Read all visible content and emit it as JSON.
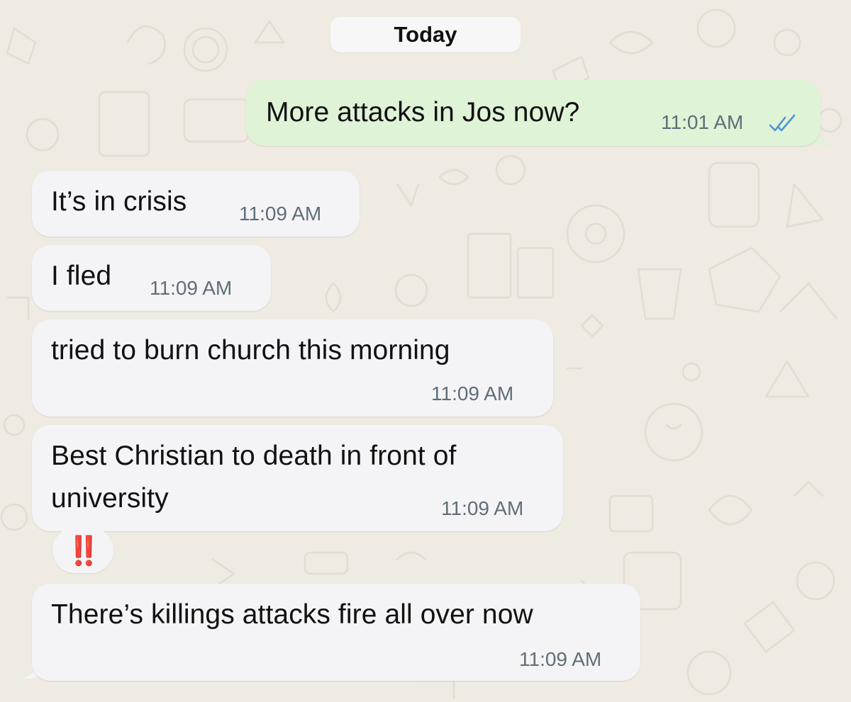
{
  "chat": {
    "date_label": "Today",
    "messages": [
      {
        "direction": "outgoing",
        "text": "More attacks in Jos now?",
        "time": "11:01 AM",
        "status": "read"
      },
      {
        "direction": "incoming",
        "text": "It’s in crisis",
        "time": "11:09 AM"
      },
      {
        "direction": "incoming",
        "text": "I fled",
        "time": "11:09 AM"
      },
      {
        "direction": "incoming",
        "text": "tried to burn church this morning",
        "time": "11:09 AM"
      },
      {
        "direction": "incoming",
        "lines": [
          "Best Christian to death in front of",
          "university"
        ],
        "time": "11:09 AM",
        "reaction": "‼️"
      },
      {
        "direction": "incoming",
        "text": "There’s killings attacks fire all over now",
        "time": "11:09 AM"
      }
    ]
  },
  "icons": {
    "read_receipt": "double-check-icon",
    "reaction": "double-exclamation-icon"
  },
  "colors": {
    "wallpaper": "#efeae2",
    "incoming_bubble": "#f4f4f6",
    "outgoing_bubble": "#dff3d6",
    "read_ticks": "#4f93d9",
    "reaction": "#d9281b"
  }
}
